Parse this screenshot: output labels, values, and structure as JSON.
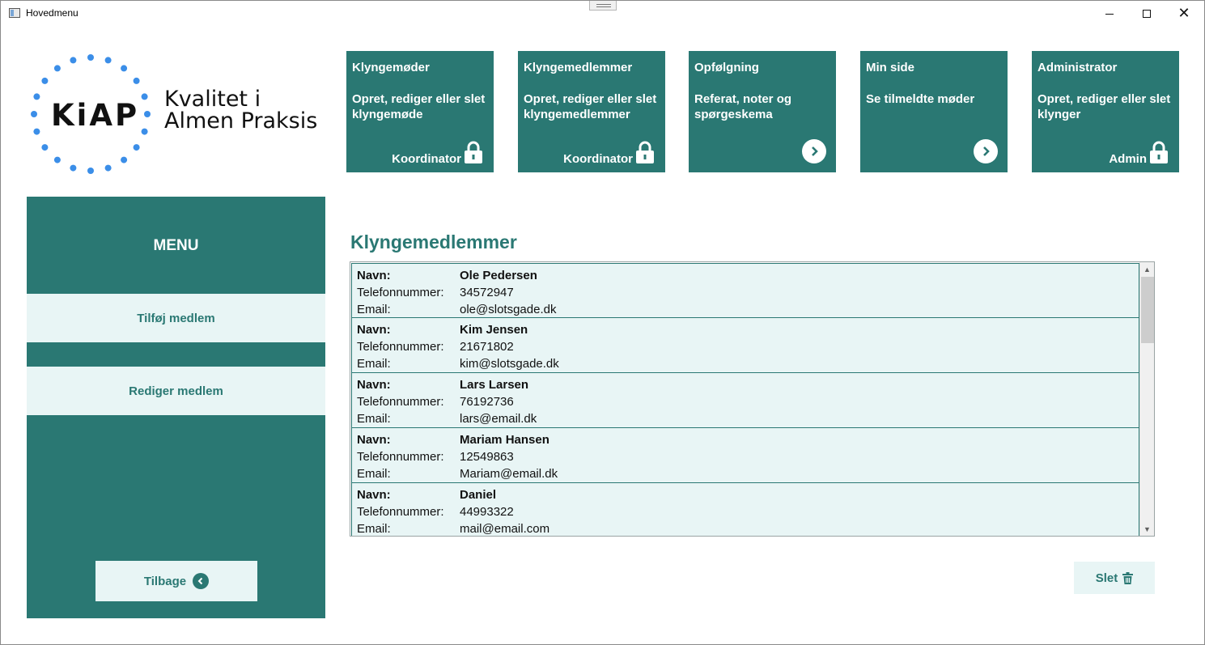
{
  "window": {
    "title": "Hovedmenu",
    "controls": {
      "minimize_icon": "minimize-icon",
      "maximize_icon": "maximize-icon",
      "close_icon": "close-icon"
    }
  },
  "logo": {
    "mark": "KiAP",
    "tagline_line1": "Kvalitet i",
    "tagline_line2": "Almen Praksis",
    "dot_color": "#3b8ee8"
  },
  "colors": {
    "primary": "#2a7873",
    "light": "#e8f5f5",
    "text_on_primary": "#ffffff"
  },
  "tiles": [
    {
      "title": "Klyngemøder",
      "description": "Opret, rediger eller slet klyngemøde",
      "role": "Koordinator",
      "icon": "lock-icon"
    },
    {
      "title": "Klyngemedlemmer",
      "description": "Opret, rediger eller slet klyngemedlemmer",
      "role": "Koordinator",
      "icon": "lock-icon"
    },
    {
      "title": "Opfølgning",
      "description": "Referat, noter og spørgeskema",
      "role": "",
      "icon": "arrow-right-icon"
    },
    {
      "title": "Min side",
      "description": "Se tilmeldte møder",
      "role": "",
      "icon": "arrow-right-icon"
    },
    {
      "title": "Administrator",
      "description": "Opret, rediger eller slet klynger",
      "role": "Admin",
      "icon": "lock-icon"
    }
  ],
  "sidebar": {
    "title": "MENU",
    "add_label": "Tilføj medlem",
    "edit_label": "Rediger medlem",
    "back_label": "Tilbage",
    "back_icon": "arrow-left-icon"
  },
  "main": {
    "heading": "Klyngemedlemmer",
    "labels": {
      "name": "Navn:",
      "phone": "Telefonnummer:",
      "email": "Email:"
    },
    "members": [
      {
        "name": "Ole Pedersen",
        "phone": "34572947",
        "email": "ole@slotsgade.dk"
      },
      {
        "name": "Kim Jensen",
        "phone": "21671802",
        "email": "kim@slotsgade.dk"
      },
      {
        "name": "Lars Larsen",
        "phone": "76192736",
        "email": "lars@email.dk"
      },
      {
        "name": "Mariam Hansen",
        "phone": "12549863",
        "email": "Mariam@email.dk"
      },
      {
        "name": "Daniel",
        "phone": "44993322",
        "email": "mail@email.com"
      }
    ],
    "delete_label": "Slet",
    "delete_icon": "trash-icon"
  }
}
